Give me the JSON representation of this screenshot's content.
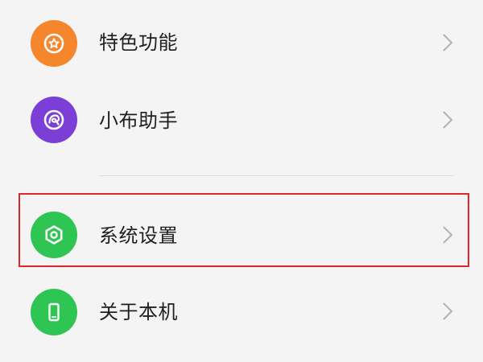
{
  "menu": {
    "items": [
      {
        "label": "特色功能",
        "icon": "star-badge-icon",
        "color": "#f5862b"
      },
      {
        "label": "小布助手",
        "icon": "assistant-icon",
        "color": "#7b3fd8"
      },
      {
        "label": "系统设置",
        "icon": "settings-hexagon-icon",
        "color": "#2fc552"
      },
      {
        "label": "关于本机",
        "icon": "phone-icon",
        "color": "#2fc552"
      }
    ],
    "chevron_icon": "chevron-right-icon",
    "highlight_color": "#e0252b"
  }
}
